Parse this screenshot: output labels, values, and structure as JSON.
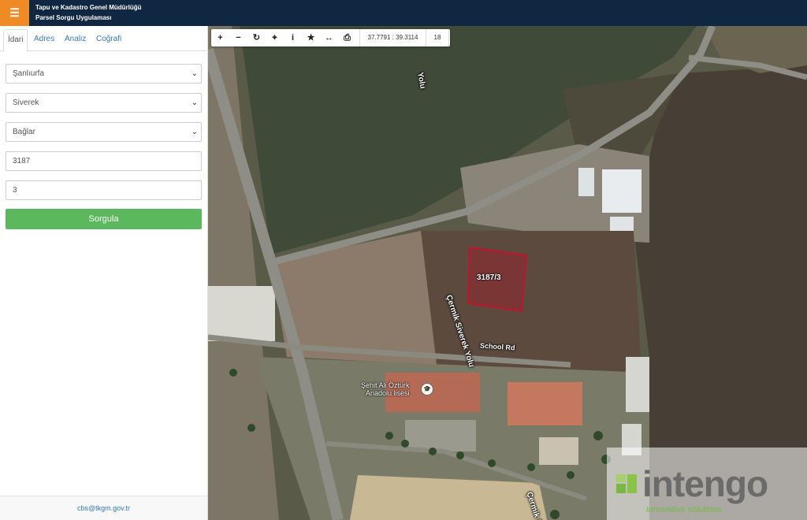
{
  "header": {
    "menu_icon": "☰",
    "title_line1": "Tapu ve Kadastro Genel Müdürlüğü",
    "title_line2": "Parsel Sorgu Uygulaması",
    "accent_color": "#f08a24",
    "bar_color": "#0f2740"
  },
  "sidebar": {
    "tabs": [
      {
        "label": "İdari",
        "active": true
      },
      {
        "label": "Adres",
        "active": false
      },
      {
        "label": "Analiz",
        "active": false
      },
      {
        "label": "Coğrafi",
        "active": false
      }
    ],
    "province": "Şanlıurfa",
    "district": "Siverek",
    "neighborhood": "Bağlar",
    "block_no": "3187",
    "parcel_no": "3",
    "query_button": "Sorgula",
    "footer_email": "cbs@tkgm.gov.tr"
  },
  "toolbar": {
    "tools": [
      {
        "name": "zoom-in-icon",
        "glyph": "+"
      },
      {
        "name": "zoom-out-icon",
        "glyph": "−"
      },
      {
        "name": "refresh-icon",
        "glyph": "↻"
      },
      {
        "name": "locate-icon",
        "glyph": "⌖"
      },
      {
        "name": "info-icon",
        "glyph": "i"
      },
      {
        "name": "star-icon",
        "glyph": "★"
      },
      {
        "name": "measure-icon",
        "glyph": "↔"
      },
      {
        "name": "print-icon",
        "glyph": "⎙"
      }
    ],
    "coordinates": "37.7791 : 39.3114",
    "zoom_level": "18"
  },
  "map": {
    "parcel_label": "3187/3",
    "road_school": "School Rd",
    "road_cermik_1": "Çermik Siverek Yolu",
    "road_cermik_2": "Çermik Siver",
    "road_yolu": "Yolu",
    "poi_line1": "Şehit Ali Öztürk",
    "poi_line2": "Anadolu lisesi",
    "parcel_color": "#c0142c"
  },
  "watermark": {
    "brand": "intengo",
    "tagline": "innovative solutions"
  }
}
